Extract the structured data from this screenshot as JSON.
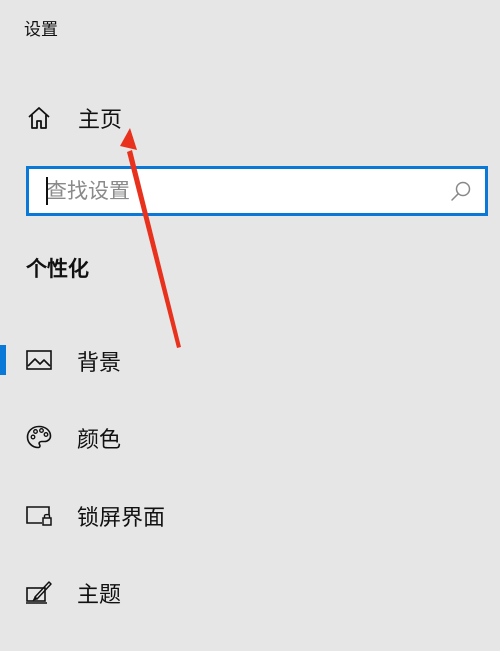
{
  "app": {
    "title": "设置"
  },
  "nav": {
    "home": {
      "label": "主页",
      "icon": "home-icon"
    }
  },
  "search": {
    "value": "",
    "placeholder": "查找设置",
    "icon": "search-icon"
  },
  "section": {
    "title": "个性化"
  },
  "items": [
    {
      "label": "背景",
      "icon": "image-icon",
      "active": true
    },
    {
      "label": "颜色",
      "icon": "palette-icon",
      "active": false
    },
    {
      "label": "锁屏界面",
      "icon": "lock-screen-icon",
      "active": false
    },
    {
      "label": "主题",
      "icon": "theme-icon",
      "active": false
    }
  ],
  "colors": {
    "accent": "#0a78d7",
    "background": "#e6e6e6",
    "annotation": "#e8321e"
  }
}
